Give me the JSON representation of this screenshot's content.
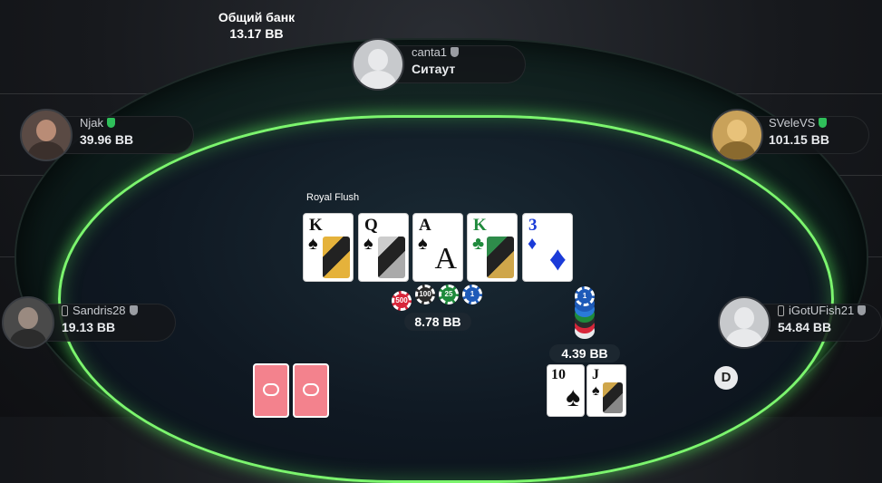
{
  "pot": {
    "label": "Общий банк",
    "amount": "13.17 BB"
  },
  "board": {
    "hand_label": "Royal Flush",
    "cards": [
      {
        "rank": "K",
        "suit": "♠",
        "color": "black"
      },
      {
        "rank": "Q",
        "suit": "♠",
        "color": "black"
      },
      {
        "rank": "A",
        "suit": "♠",
        "color": "black"
      },
      {
        "rank": "K",
        "suit": "♣",
        "color": "green"
      },
      {
        "rank": "3",
        "suit": "♦",
        "color": "blue"
      }
    ]
  },
  "players": {
    "top": {
      "name": "canta1",
      "stack": "Ситаут"
    },
    "left_top": {
      "name": "Njak",
      "stack": "39.96 BB"
    },
    "right_top": {
      "name": "SVeleVS",
      "stack": "101.15 BB"
    },
    "left_bottom": {
      "name": "Sandris28",
      "stack": "19.13 BB"
    },
    "right_bottom": {
      "name": "iGotUFish21",
      "stack": "54.84 BB"
    }
  },
  "pot_chips": {
    "chips": [
      {
        "value": "500",
        "color": "#d8263a"
      },
      {
        "value": "100",
        "color": "#2b2b2b"
      },
      {
        "value": "25",
        "color": "#1e8a3b"
      },
      {
        "value": "1",
        "color": "#1e5ab8"
      }
    ],
    "amount": "8.78 BB"
  },
  "hero_bet": {
    "chip": "1",
    "amount": "4.39 BB"
  },
  "hero_cards": [
    {
      "rank": "10",
      "suit": "♠",
      "color": "black"
    },
    {
      "rank": "J",
      "suit": "♠",
      "color": "black"
    }
  ],
  "dealer_button": "D",
  "colors": {
    "felt_rim": "#7cf56e",
    "verified_shield": "#2fbf5a",
    "shield_grey": "#9a9da3"
  }
}
